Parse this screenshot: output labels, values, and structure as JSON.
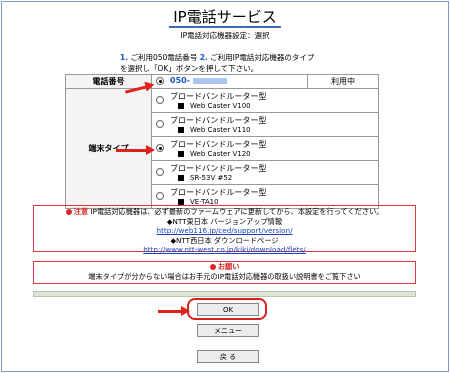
{
  "page": {
    "title": "IP電話サービス",
    "subtitle": "IP電話対応機器設定：選択",
    "instruction_line1_num1": "1.",
    "instruction_line1_a": "ご利用050電話番号",
    "instruction_line1_num2": "2.",
    "instruction_line1_b": "ご利用IP電話対応機器のタイプ",
    "instruction_line2": "を選択し「OK」ボタンを押して下さい。"
  },
  "table": {
    "phone_label": "電話番号",
    "phone_number": "050-",
    "phone_status": "利用中",
    "terminal_label": "端末タイプ",
    "options": [
      {
        "line1": "ブロードバンドルーター型",
        "line2": "Web Caster V100",
        "selected": false
      },
      {
        "line1": "ブロードバンドルーター型",
        "line2": "Web Caster V110",
        "selected": false
      },
      {
        "line1": "ブロードバンドルーター型",
        "line2": "Web Caster V120",
        "selected": true
      },
      {
        "line1": "ブロードバンドルーター型",
        "line2": "SR-53V #52",
        "selected": false
      },
      {
        "line1": "ブロードバンドルーター型",
        "line2": "VE-TA10",
        "selected": false
      }
    ]
  },
  "notice": {
    "tag": "注意",
    "text": "IP電話対応機器は、必ず最新のファームウェアに更新してから、本設定を行ってください。",
    "east_label": "◆NTT東日本 バージョンアップ情報",
    "east_url": "http://web116.jp/ced/support/version/",
    "west_label": "◆NTT西日本 ダウンロードページ",
    "west_url": "http://www.ntt-west.co.jp/kiki/download/flets/"
  },
  "advice": {
    "tag": "お願い",
    "text": "端末タイプが分からない場合はお手元のIP電話対応機器の取扱い説明書をご覧下さい"
  },
  "buttons": {
    "ok": "OK",
    "menu": "メニュー",
    "back": "戻 る"
  },
  "colors": {
    "arrow": "#e0201a",
    "link": "#1a44c4",
    "accent": "#3a6bb3"
  }
}
